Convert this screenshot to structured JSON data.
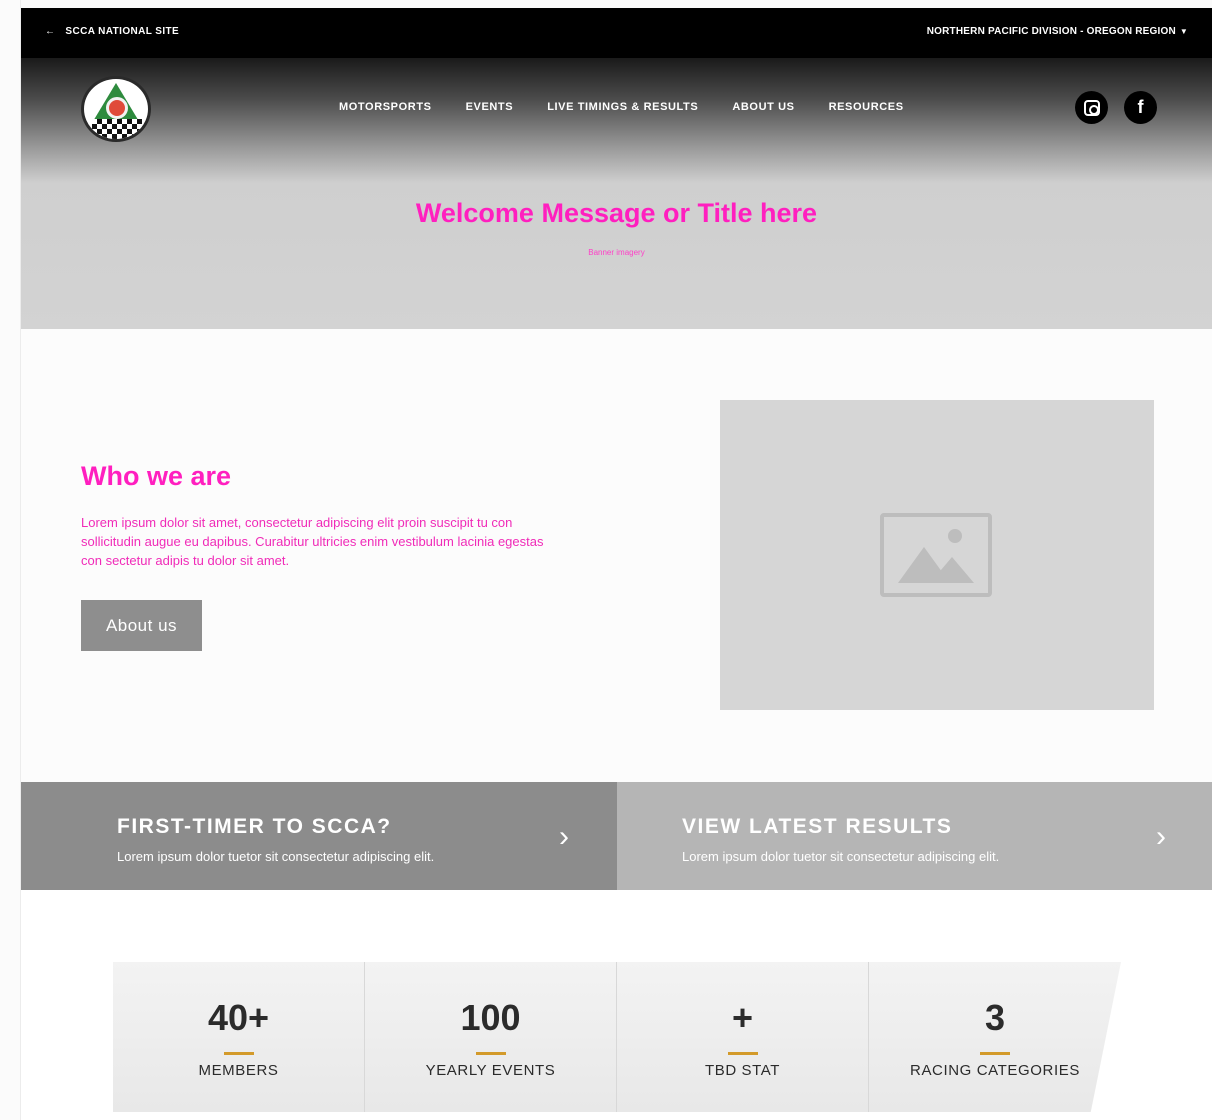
{
  "topbar": {
    "back_label": "SCCA NATIONAL SITE",
    "region_label": "NORTHERN PACIFIC DIVISION - OREGON REGION"
  },
  "nav": {
    "items": [
      "MOTORSPORTS",
      "EVENTS",
      "LIVE TIMINGS & RESULTS",
      "ABOUT US",
      "RESOURCES"
    ]
  },
  "social": [
    "instagram-icon",
    "facebook-icon"
  ],
  "hero": {
    "title": "Welcome Message or Title here",
    "subtitle": "Banner imagery"
  },
  "who": {
    "heading": "Who we are",
    "body": "Lorem ipsum dolor sit amet, consectetur adipiscing elit proin suscipit tu con sollicitudin augue eu dapibus. Curabitur ultricies enim vestibulum lacinia egestas con sectetur adipis tu dolor sit amet.",
    "button_label": "About us"
  },
  "cta": [
    {
      "heading": "FIRST-TIMER TO SCCA?",
      "text": "Lorem ipsum dolor tuetor sit consectetur adipiscing elit."
    },
    {
      "heading": "VIEW LATEST RESULTS",
      "text": "Lorem ipsum dolor tuetor sit consectetur adipiscing elit."
    }
  ],
  "stats": [
    {
      "value": "40+",
      "label": "MEMBERS"
    },
    {
      "value": "100",
      "label": "YEARLY EVENTS"
    },
    {
      "value": "+",
      "label": "TBD STAT"
    },
    {
      "value": "3",
      "label": "RACING CATEGORIES"
    }
  ],
  "colors": {
    "accent_pink": "#ff1fbf",
    "stat_bar": "#d39a2a",
    "button_gray": "#8e8e8e"
  }
}
